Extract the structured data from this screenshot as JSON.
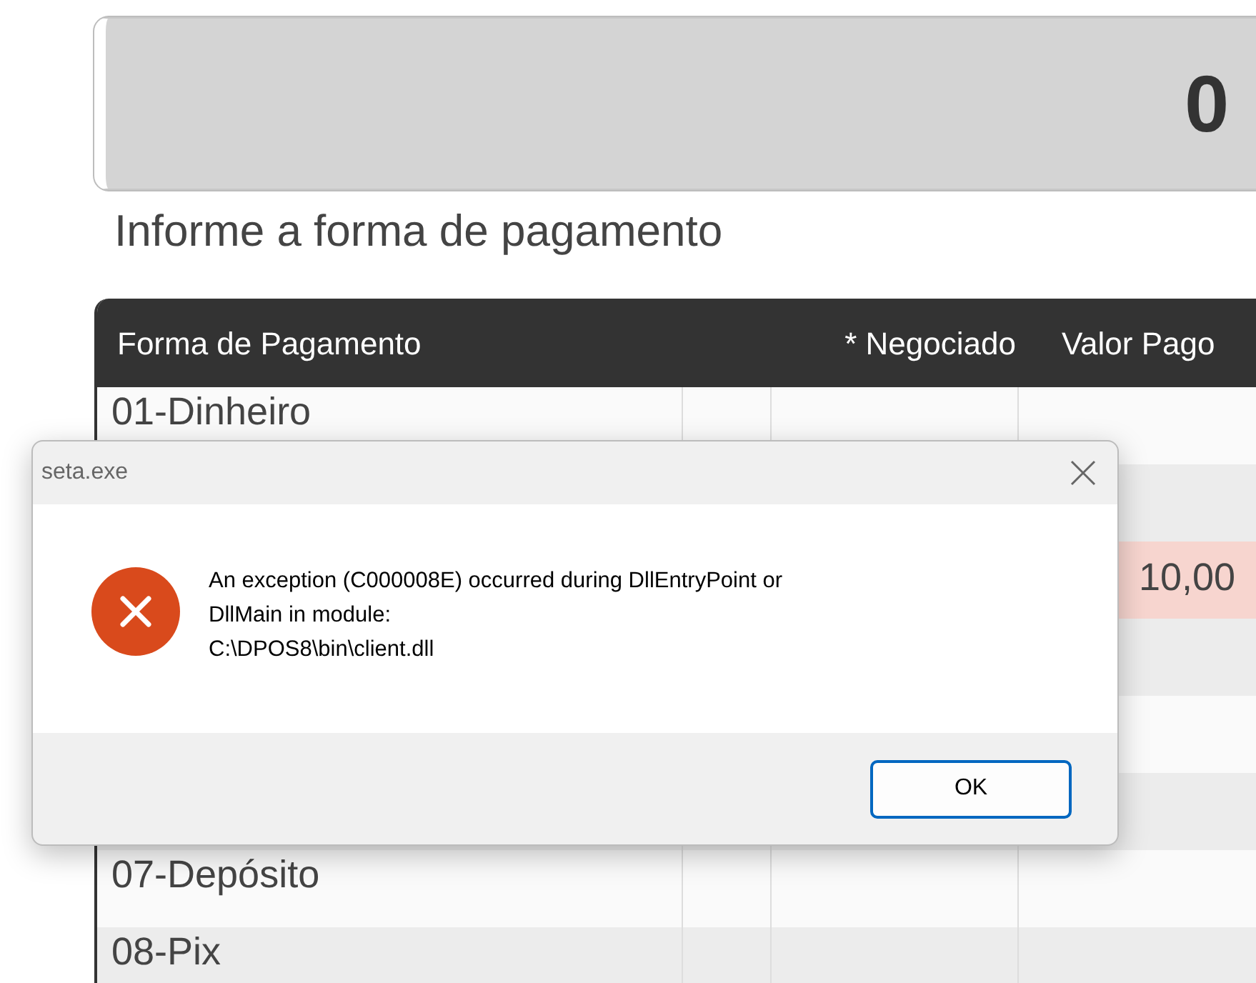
{
  "display": {
    "value": "0"
  },
  "prompt": "Informe a forma de pagamento",
  "table": {
    "columns": [
      "Forma de Pagamento",
      "* Negociado",
      "Valor Pago"
    ],
    "rows": [
      {
        "forma": "01-Dinheiro",
        "highlighted": false
      },
      {
        "highlighted": false
      },
      {
        "valor_pago": "10,00",
        "highlighted": true
      },
      {
        "highlighted": false
      },
      {
        "highlighted": false
      },
      {
        "highlighted": false
      },
      {
        "forma": "07-Depósito",
        "highlighted": false
      },
      {
        "forma": "08-Pix",
        "highlighted": false
      }
    ]
  },
  "dialog": {
    "title": "seta.exe",
    "message_lines": [
      "An exception (C000008E) occurred during DllEntryPoint or",
      "DllMain in module:",
      "C:\\DPOS8\\bin\\client.dll"
    ],
    "button": "OK"
  }
}
